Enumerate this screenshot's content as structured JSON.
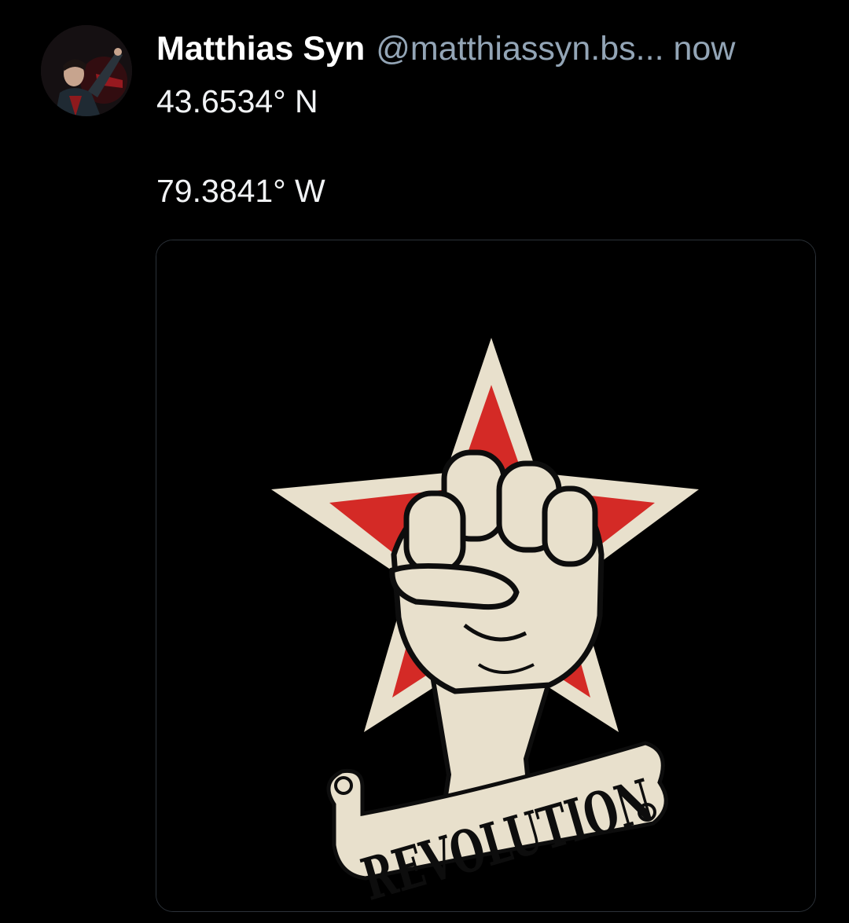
{
  "post": {
    "author": {
      "display_name": "Matthias Syn",
      "handle": "@matthiassyn.bs...",
      "avatar_icon": "user-avatar"
    },
    "timestamp": "now",
    "text_lines": [
      "43.6534° N",
      "79.3841° W"
    ],
    "media": {
      "banner_text": "REVOLUTION",
      "icon": "raised-fist-star-image"
    }
  },
  "colors": {
    "background": "#000000",
    "text_primary": "#ffffff",
    "text_secondary": "#93a5b6",
    "card_border": "#2c3239",
    "star_red": "#d42a26",
    "star_cream": "#e8e0cc"
  }
}
